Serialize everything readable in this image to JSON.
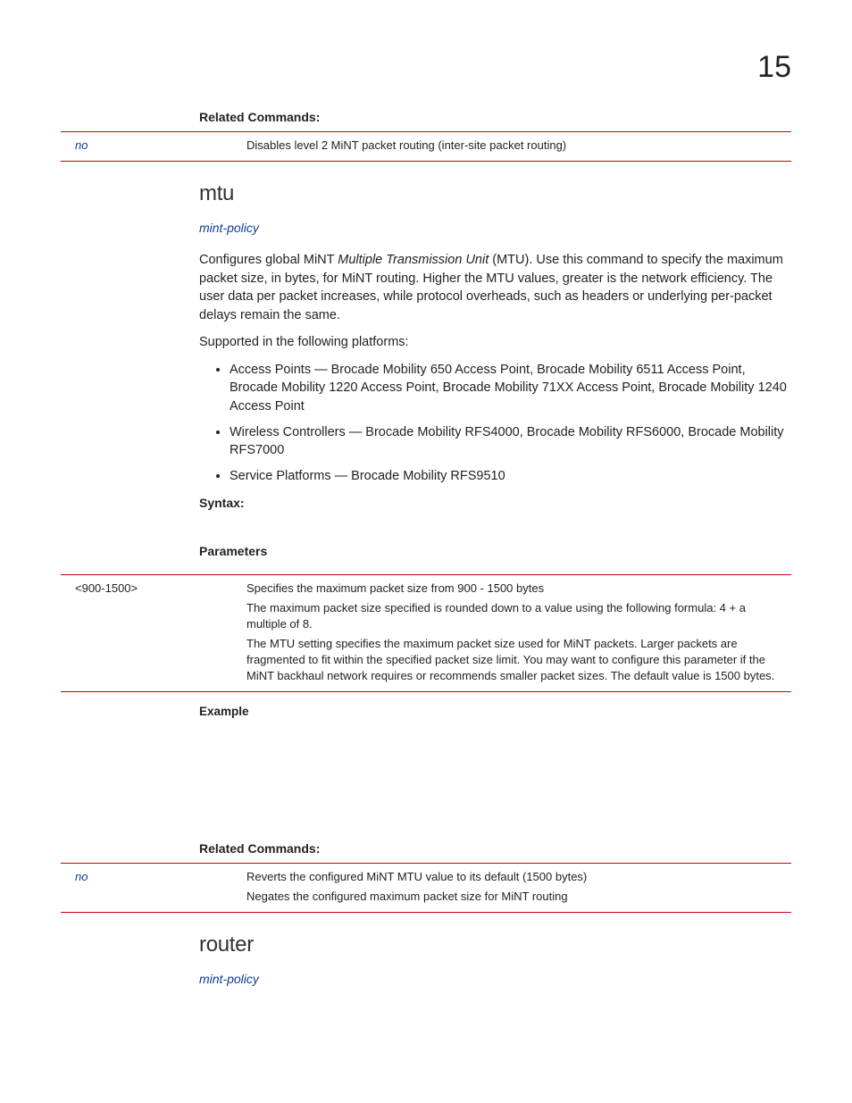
{
  "chapter_number": "15",
  "sections": {
    "related1": {
      "heading": "Related Commands:",
      "rows": [
        {
          "key": "no",
          "desc": [
            "Disables level 2 MiNT packet routing (inter-site packet routing)"
          ]
        }
      ]
    },
    "mtu": {
      "heading": "mtu",
      "policy_link": "mint-policy",
      "intro_pre": "Configures global MiNT ",
      "intro_em": "Multiple Transmission Unit",
      "intro_post": " (MTU). Use this command to specify the maximum packet size, in bytes, for MiNT routing. Higher the MTU values, greater is the network efficiency. The user data per packet increases, while protocol overheads, such as headers or underlying per-packet delays remain the same.",
      "supported_line": "Supported in the following platforms:",
      "platforms": [
        "Access Points — Brocade Mobility 650 Access Point, Brocade Mobility 6511 Access Point, Brocade Mobility 1220 Access Point, Brocade Mobility 71XX Access Point, Brocade Mobility 1240 Access Point",
        "Wireless Controllers — Brocade Mobility RFS4000, Brocade Mobility RFS6000, Brocade Mobility RFS7000",
        "Service Platforms — Brocade Mobility RFS9510"
      ],
      "syntax_heading": "Syntax:",
      "parameters_heading": "Parameters",
      "param_rows": [
        {
          "key": "<900-1500>",
          "desc": [
            "Specifies the maximum packet size from 900 - 1500 bytes",
            "The maximum packet size specified is rounded down to a value using the following formula: 4 + a multiple of 8.",
            "The MTU setting specifies the maximum packet size used for MiNT packets. Larger packets are fragmented to fit within the specified packet size limit. You may want to configure this parameter if the MiNT backhaul network requires or recommends smaller packet sizes. The default value is 1500 bytes."
          ]
        }
      ],
      "example_heading": "Example"
    },
    "related2": {
      "heading": "Related Commands:",
      "rows": [
        {
          "key": "no",
          "desc": [
            "Reverts the configured MiNT MTU value to its default (1500 bytes)",
            "Negates the configured maximum packet size for MiNT routing"
          ]
        }
      ]
    },
    "router": {
      "heading": "router",
      "policy_link": "mint-policy"
    }
  }
}
